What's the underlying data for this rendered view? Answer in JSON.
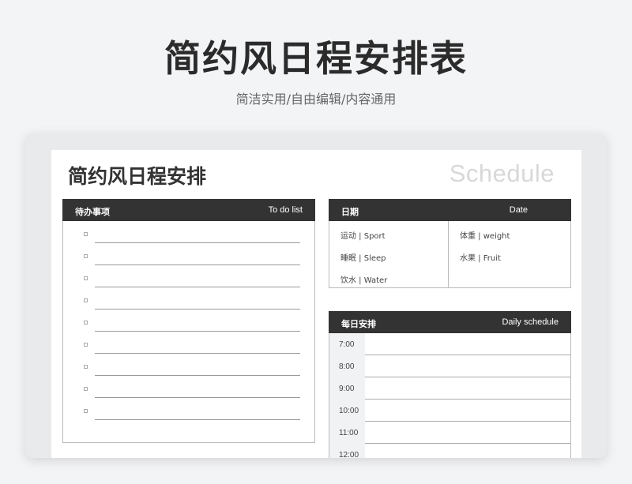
{
  "hero": {
    "title": "简约风日程安排表",
    "subtitle": "简洁实用/自由编辑/内容通用"
  },
  "sheet": {
    "title": "简约风日程安排",
    "watermark": "Schedule"
  },
  "todo": {
    "title_cn": "待办事项",
    "title_en": "To do list",
    "items": [
      "",
      "",
      "",
      "",
      "",
      "",
      "",
      "",
      ""
    ]
  },
  "date_panel": {
    "title_cn": "日期",
    "title_en": "Date",
    "left_stats": [
      "运动 | Sport",
      "睡眠 | Sleep",
      "饮水 | Water"
    ],
    "right_stats": [
      "体重 | weight",
      "水果 | Fruit"
    ]
  },
  "daily": {
    "title_cn": "每日安排",
    "title_en": "Daily schedule",
    "times": [
      "7:00",
      "8:00",
      "9:00",
      "10:00",
      "11:00",
      "12:00"
    ]
  }
}
